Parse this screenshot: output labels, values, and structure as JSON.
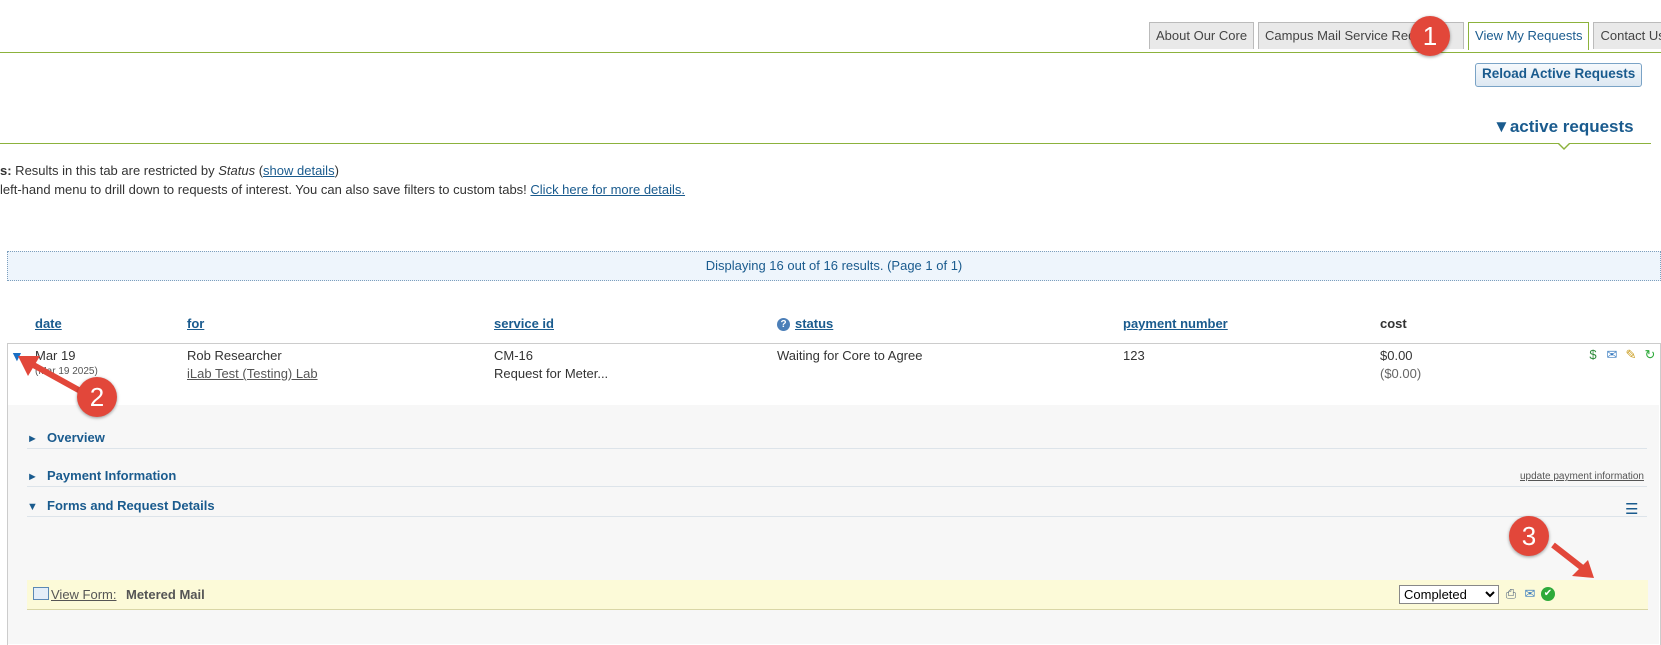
{
  "tabs": [
    {
      "label": "About Our Core",
      "active": false
    },
    {
      "label": "Campus Mail Service Requests",
      "active": false
    },
    {
      "label": "View My Requests",
      "active": true
    },
    {
      "label": "Contact Us",
      "active": false
    }
  ],
  "reload_label": "Reload Active Requests",
  "active_heading": "▼active requests",
  "notice": {
    "line1_prefix": "s:",
    "line1_text": " Results in this tab are restricted by ",
    "line1_italic": "Status",
    "line1_open": " (",
    "line1_link": "show details",
    "line1_close": ")",
    "line2_text": " left-hand menu to drill down to requests of interest. You can also save filters to custom tabs! ",
    "line2_link": "Click here for more details."
  },
  "results_summary": "Displaying 16 out of 16 results. (Page 1 of 1)",
  "columns": {
    "date": "date",
    "for": "for",
    "service_id": "service id",
    "status": "status",
    "payment_number": "payment number",
    "cost": "cost"
  },
  "request": {
    "date": "Mar 19",
    "date_sub": "(Mar 19 2025)",
    "for_name": "Rob Researcher",
    "for_lab": "iLab Test (Testing) Lab",
    "service_id": "CM-16",
    "service_desc": "Request for Meter...",
    "status": "Waiting for Core to Agree",
    "payment_number": "123",
    "cost": "$0.00",
    "cost_sub": "($0.00)"
  },
  "sections": {
    "overview": "Overview",
    "payment": "Payment Information",
    "forms": "Forms and Request Details",
    "update_payment": "update payment information"
  },
  "form": {
    "view_label": "View Form:",
    "name": "Metered Mail",
    "status_options": [
      "Completed"
    ],
    "status_selected": "Completed"
  },
  "annotations": [
    "1",
    "2",
    "3"
  ],
  "icons": {
    "row": [
      "edit-money-icon",
      "comments-icon",
      "edit-pencil-icon",
      "refresh-icon"
    ],
    "form": [
      "print-icon",
      "email-icon",
      "check-icon"
    ]
  },
  "colors": {
    "accent_green": "#8cb23c",
    "link_blue": "#1a5b8e",
    "badge_red": "#e2473a"
  }
}
